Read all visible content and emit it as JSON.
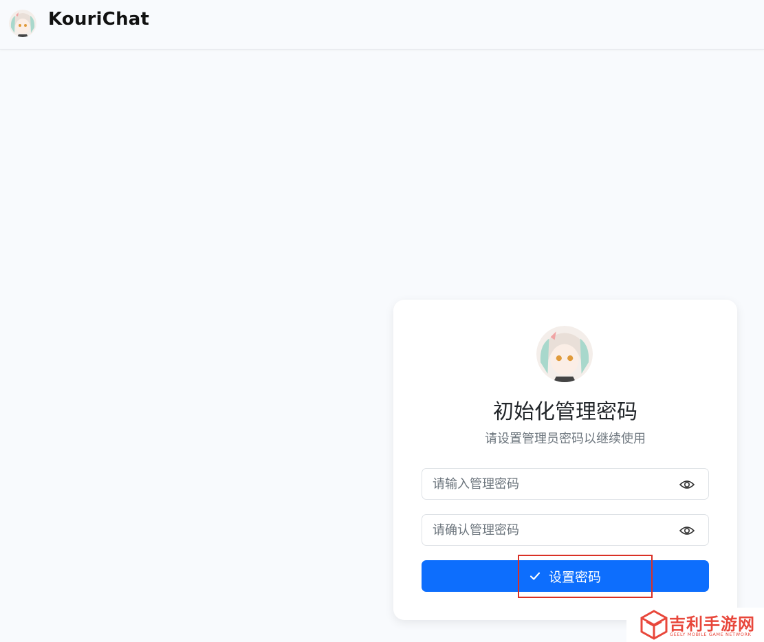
{
  "header": {
    "brand": "KouriChat",
    "avatar_icon": "anime-character-avatar-icon"
  },
  "card": {
    "avatar_icon": "anime-character-avatar-icon",
    "title": "初始化管理密码",
    "subtitle": "请设置管理员密码以继续使用",
    "password_field": {
      "placeholder": "请输入管理密码",
      "value": "",
      "toggle_icon": "eye-icon"
    },
    "confirm_field": {
      "placeholder": "请确认管理密码",
      "value": "",
      "toggle_icon": "eye-icon"
    },
    "submit": {
      "label": "设置密码",
      "icon": "check-icon"
    }
  },
  "watermark": {
    "text": "吉利手游网",
    "subtext": "GEELY MOBILE GAME NETWORK"
  },
  "colors": {
    "primary": "#0d6efd",
    "background": "#f8fafd",
    "card": "#ffffff",
    "highlight": "#d93025",
    "watermark": "#e8473b"
  }
}
